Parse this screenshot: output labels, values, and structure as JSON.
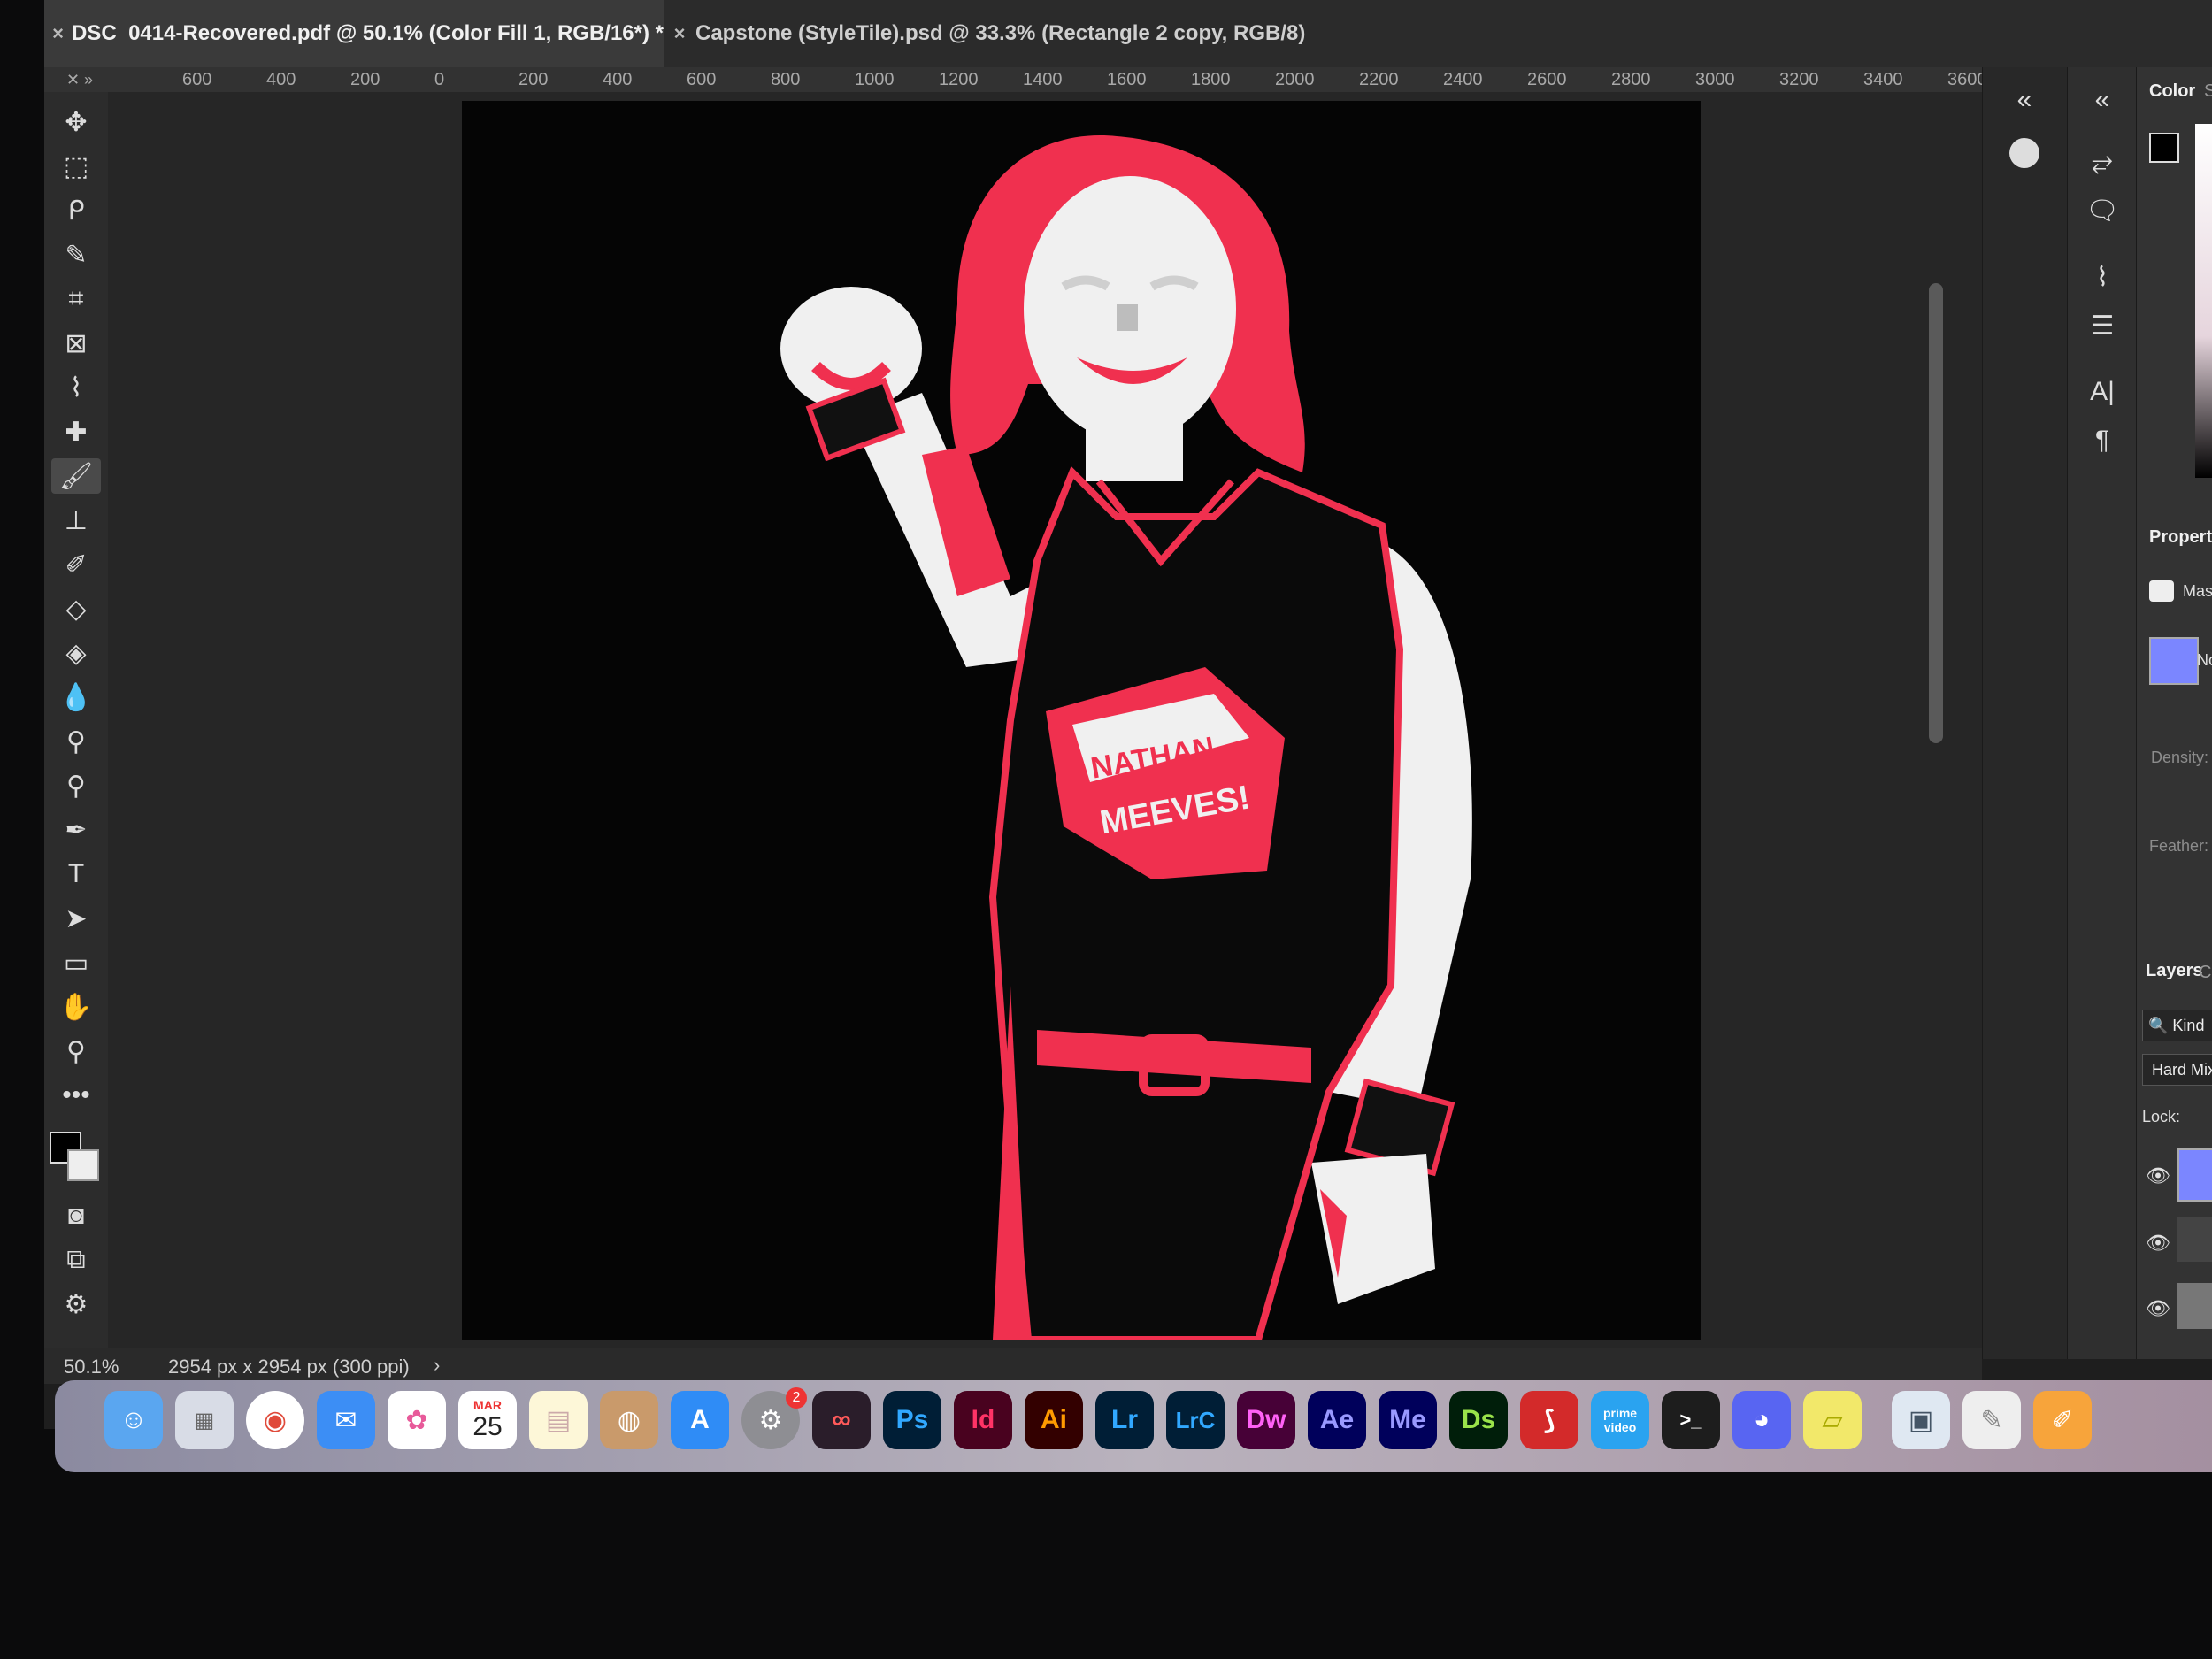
{
  "tabs": [
    {
      "label": "DSC_0414-Recovered.pdf @ 50.1% (Color Fill 1, RGB/16*) *"
    },
    {
      "label": "Capstone (StyleTile).psd @ 33.3% (Rectangle 2 copy, RGB/8)"
    }
  ],
  "ruler_ticks": [
    "600",
    "400",
    "200",
    "0",
    "200",
    "400",
    "600",
    "800",
    "1000",
    "1200",
    "1400",
    "1600",
    "1800",
    "2000",
    "2200",
    "2400",
    "2600",
    "2800",
    "3000",
    "3200",
    "3400",
    "3600"
  ],
  "status": {
    "zoom": "50.1%",
    "dimensions": "2954 px x 2954 px (300 ppi)",
    "more": "›"
  },
  "artwork": {
    "shirt_text_1": "NATHAN",
    "shirt_text_2": "MEEVES!"
  },
  "panels": {
    "color_tab": "Color",
    "swatches_tab": "Swatches",
    "properties_tab": "Properties",
    "masks_label": "Masks",
    "no_mask": "No mask",
    "density_label": "Density:",
    "feather_label": "Feather:",
    "layers_tab": "Layers",
    "channels_tab": "Channels",
    "kind_filter": "Kind",
    "blend_mode": "Hard Mix",
    "lock_label": "Lock:"
  },
  "dock": {
    "calendar_month": "MAR",
    "calendar_day": "25",
    "settings_badge": "2",
    "apps": [
      "Ps",
      "Id",
      "Ai",
      "Lr",
      "LrC",
      "Dw",
      "Ae",
      "Me",
      "Ds"
    ],
    "prime_video": "prime video"
  },
  "colors": {
    "accent_red": "#f0304f",
    "layer_blue": "#7b86ff",
    "ps_blue": "#31a8ff",
    "id_pink": "#ff3366",
    "ai_orange": "#ff9a00",
    "dw_magenta": "#ff61f6",
    "ae_violet": "#9999ff",
    "me_violet": "#9999ff",
    "ds_green": "#9ae34a"
  }
}
